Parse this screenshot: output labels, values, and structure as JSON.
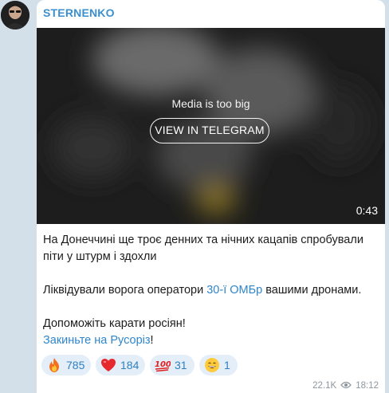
{
  "channel": {
    "name": "STERNENKO"
  },
  "media": {
    "notice": "Media is too big",
    "button_label": "VIEW IN TELEGRAM",
    "duration": "0:43"
  },
  "message": {
    "line1": "На Донеччині ще троє денних та нічних кацапів спробували піти у штурм і здохли",
    "line2_before": "Ліквідували ворога оператори ",
    "line2_link": "30-ї ОМБр",
    "line2_after": " вашими дронами.",
    "line3": "Допоможіть карати росіян!",
    "line4_link": "Закиньте на Русоріз",
    "line4_after": "!"
  },
  "reactions": [
    {
      "emoji": "fire-emoji",
      "count": "785"
    },
    {
      "emoji": "heart-emoji",
      "count": "184"
    },
    {
      "emoji": "hundred-points-emoji",
      "count": "31"
    },
    {
      "emoji": "grinning-face-emoji",
      "count": "1"
    }
  ],
  "meta": {
    "views": "22.1K",
    "time": "18:12"
  },
  "colors": {
    "accent": "#3a8fd1",
    "link": "#2f86cc",
    "reaction_bg": "#e4eef8",
    "chat_bg": "#d3dfe9"
  }
}
